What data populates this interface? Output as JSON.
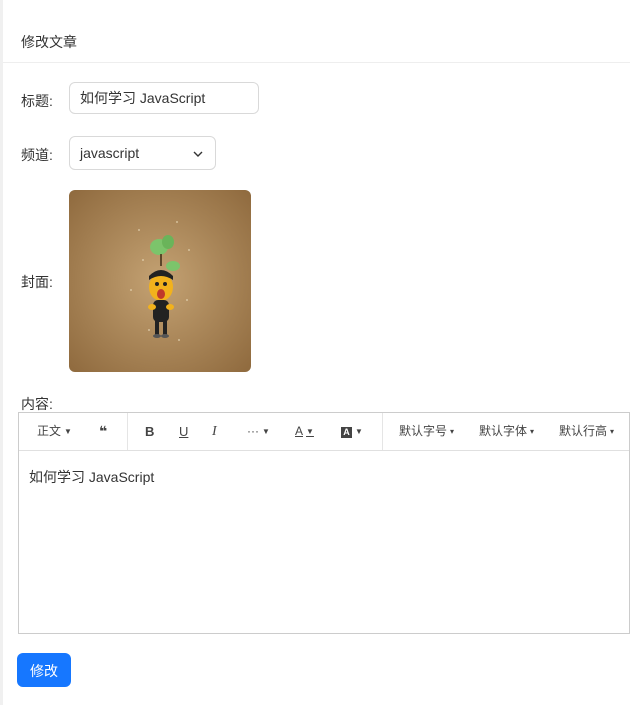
{
  "card": {
    "title": "修改文章"
  },
  "form": {
    "title_label": "标题:",
    "title_value": "如何学习 JavaScript",
    "channel_label": "频道:",
    "channel_value": "javascript",
    "cover_label": "封面:",
    "content_label": "内容:"
  },
  "toolbar": {
    "paragraph": "正文",
    "quote": "❝",
    "bold": "B",
    "underline": "U",
    "italic": "I",
    "more": "···",
    "font_color": "A",
    "bg_color": "A",
    "font_size": "默认字号",
    "font_family": "默认字体",
    "line_height": "默认行高"
  },
  "editor": {
    "content": "如何学习 JavaScript"
  },
  "submit_label": "修改",
  "colors": {
    "primary": "#1677ff",
    "cover_bg": "#a07a4a"
  }
}
